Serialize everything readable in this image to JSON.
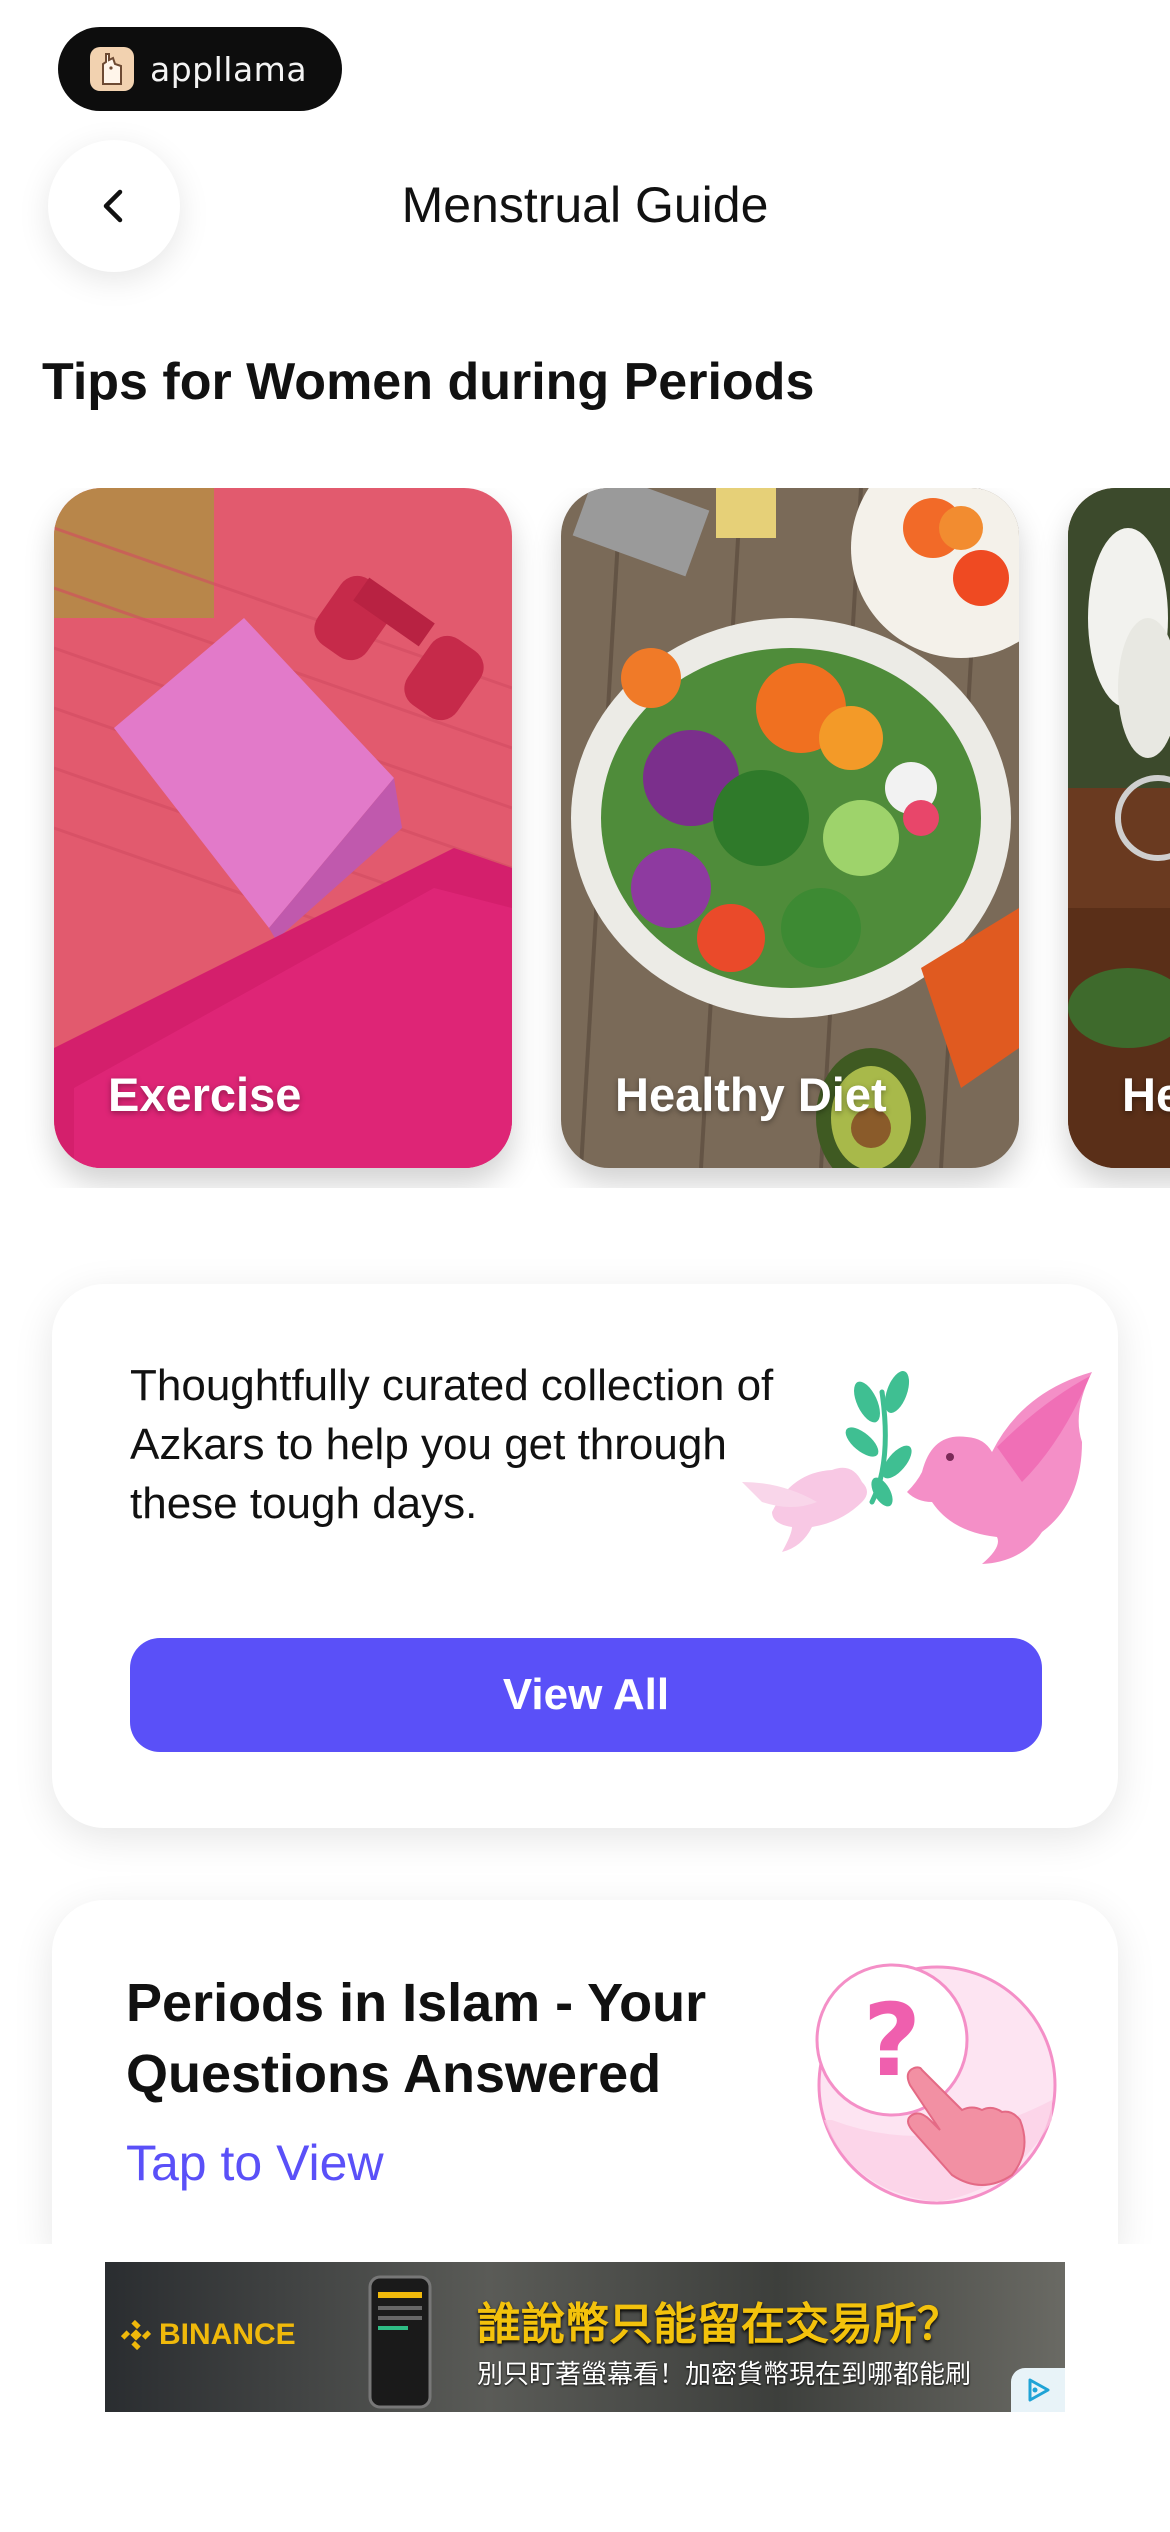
{
  "brand": {
    "name": "appllama",
    "logo_icon": "llama-icon"
  },
  "header": {
    "title": "Menstrual Guide",
    "back_icon": "chevron-left-icon"
  },
  "tips": {
    "title": "Tips for Women during Periods",
    "cards": [
      {
        "label": "Exercise"
      },
      {
        "label": "Healthy Diet"
      },
      {
        "label": "He"
      }
    ]
  },
  "azkar": {
    "description": "Thoughtfully curated collection of Azkars to help you get through these tough days.",
    "button_label": "View All",
    "illustration": "doves-with-olive-branch"
  },
  "islam": {
    "title": "Periods in Islam - Your Questions Answered",
    "link_label": "Tap to View",
    "illustration": "question-mark-pointing-hand"
  },
  "ad": {
    "brand": "BINANCE",
    "headline": "誰說幣只能留在交易所？",
    "subline": "別只盯著螢幕看！加密貨幣現在到哪都能刷",
    "ad_choices_icon": "ad-choices-icon"
  },
  "colors": {
    "accent": "#5a50f8",
    "pink": "#f48fc7"
  }
}
